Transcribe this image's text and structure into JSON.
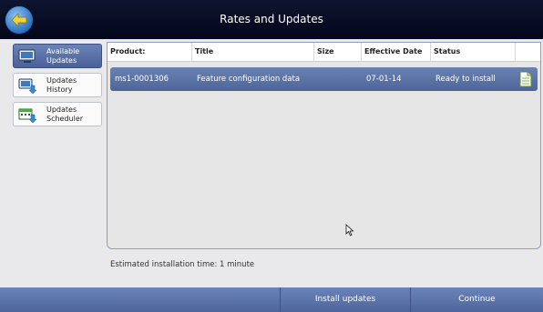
{
  "window": {
    "title": "Rates and Updates"
  },
  "sidebar": {
    "items": [
      {
        "label_line1": "Available",
        "label_line2": "Updates",
        "icon": "monitor-icon",
        "active": true
      },
      {
        "label_line1": "Updates",
        "label_line2": "History",
        "icon": "monitor-download-icon",
        "active": false
      },
      {
        "label_line1": "Updates",
        "label_line2": "Scheduler",
        "icon": "calendar-download-icon",
        "active": false
      }
    ]
  },
  "table": {
    "headers": {
      "product": "Product:",
      "title": "Title",
      "size": "Size",
      "effective_date": "Effective Date",
      "status": "Status"
    },
    "rows": [
      {
        "product": "ms1-0001306",
        "title": "Feature configuration data",
        "size": "",
        "effective_date": "07-01-14",
        "status": "Ready to install",
        "icon": "document-icon"
      }
    ]
  },
  "estimate": "Estimated installation time: 1 minute",
  "footer": {
    "install_label": "Install updates",
    "continue_label": "Continue"
  },
  "colors": {
    "accent": "#4d6599",
    "titlebar": "#03061a"
  }
}
